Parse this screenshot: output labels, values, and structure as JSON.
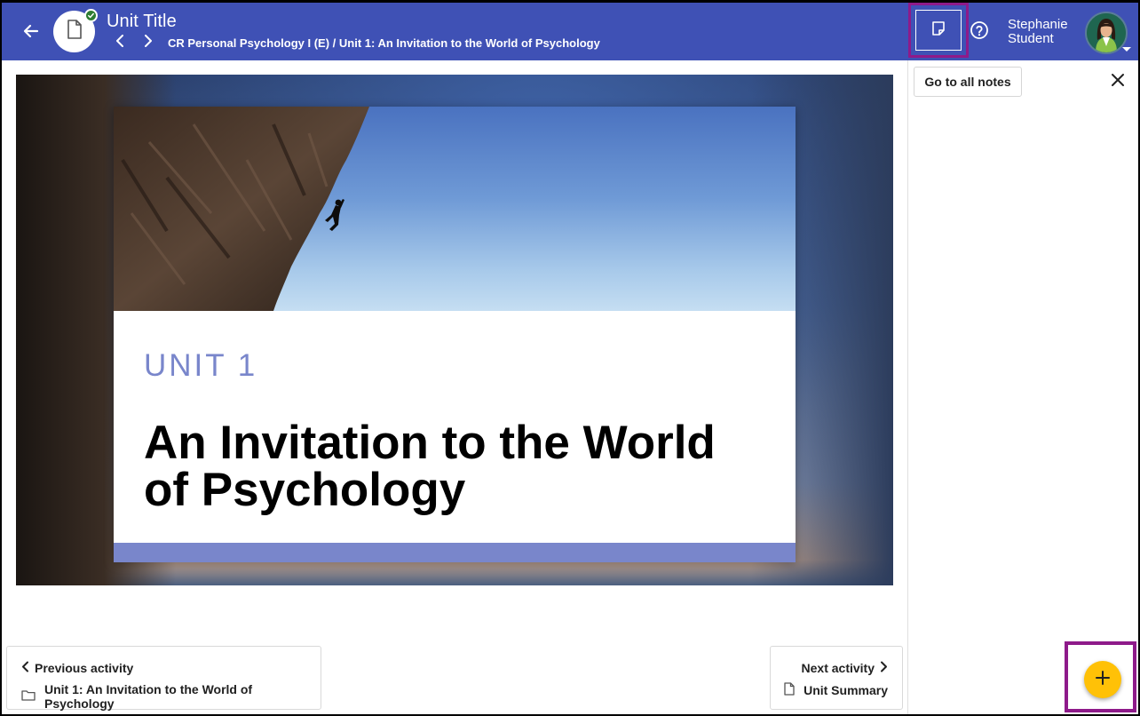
{
  "header": {
    "title": "Unit Title",
    "breadcrumb": "CR Personal Psychology I (E) / Unit 1: An Invitation to the World of Psychology",
    "user": {
      "first_name": "Stephanie",
      "last_name": "Student"
    },
    "icons": {
      "back": "arrow-left-icon",
      "document": "document-icon",
      "completed": "check-circle-icon",
      "prev": "chevron-left-icon",
      "next": "chevron-right-icon",
      "notes": "sticky-note-icon",
      "help": "help-circle-icon",
      "avatar_caret": "caret-down-icon"
    },
    "colors": {
      "bar": "#3f51b5",
      "highlight": "#8e1a8a"
    }
  },
  "slide": {
    "unit_label": "UNIT 1",
    "title": "An Invitation to the World of Psychology",
    "accent_color": "#7986cb"
  },
  "notes_panel": {
    "go_to_all_label": "Go to all notes",
    "close_icon": "close-icon",
    "add_icon": "plus-icon",
    "fab_color": "#ffc107"
  },
  "navigation": {
    "previous": {
      "label": "Previous activity",
      "item": "Unit 1: An Invitation to the World of Psychology",
      "icon": "folder-icon"
    },
    "next": {
      "label": "Next activity",
      "item": "Unit Summary",
      "icon": "document-icon"
    }
  }
}
